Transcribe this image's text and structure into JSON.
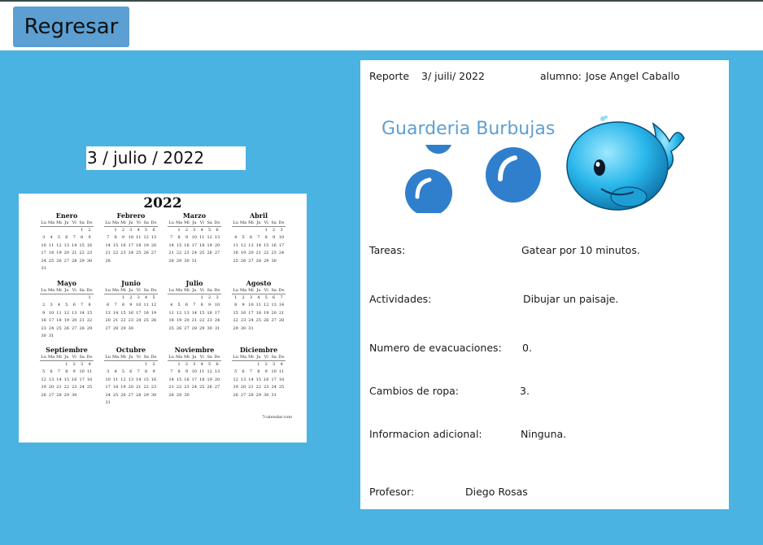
{
  "toolbar": {
    "back_label": "Regresar"
  },
  "selected_date": "3 / julio / 2022",
  "calendar": {
    "year": "2022",
    "source": "7calendar.com",
    "weekdays": [
      "Lu",
      "Ma",
      "Mi",
      "Ju",
      "Vi",
      "Sa",
      "Do"
    ],
    "months": [
      {
        "name": "Enero",
        "offset": 5,
        "days": 31
      },
      {
        "name": "Febrero",
        "offset": 1,
        "days": 28
      },
      {
        "name": "Marzo",
        "offset": 1,
        "days": 31
      },
      {
        "name": "Abril",
        "offset": 4,
        "days": 30
      },
      {
        "name": "Mayo",
        "offset": 6,
        "days": 31
      },
      {
        "name": "Junio",
        "offset": 2,
        "days": 30
      },
      {
        "name": "Julio",
        "offset": 4,
        "days": 31
      },
      {
        "name": "Agosto",
        "offset": 0,
        "days": 31
      },
      {
        "name": "Septiembre",
        "offset": 3,
        "days": 30
      },
      {
        "name": "Octubre",
        "offset": 5,
        "days": 31
      },
      {
        "name": "Noviembre",
        "offset": 1,
        "days": 30
      },
      {
        "name": "Diciembre",
        "offset": 3,
        "days": 31
      }
    ]
  },
  "report": {
    "title": "Reporte",
    "date": "3/ juili/ 2022",
    "student_label": "alumno:",
    "student_name": "Jose Angel Caballo",
    "brand": "Guarderia Burbujas",
    "fields": {
      "tasks_label": "Tareas:",
      "tasks_value": "Gatear por 10 minutos.",
      "activities_label": "Actividades:",
      "activities_value": "Dibujar un paisaje.",
      "evacuations_label": "Numero de evacuaciones:",
      "evacuations_value": "0.",
      "clothes_label": "Cambios de ropa:",
      "clothes_value": "3.",
      "info_label": "Informacion adicional:",
      "info_value": "Ninguna.",
      "teacher_label": "Profesor:",
      "teacher_value": "Diego Rosas"
    }
  },
  "colors": {
    "background": "#4ab3e2",
    "button": "#5b9fd3",
    "brand_text": "#5f9fd0",
    "bubble": "#2f7fcc"
  }
}
